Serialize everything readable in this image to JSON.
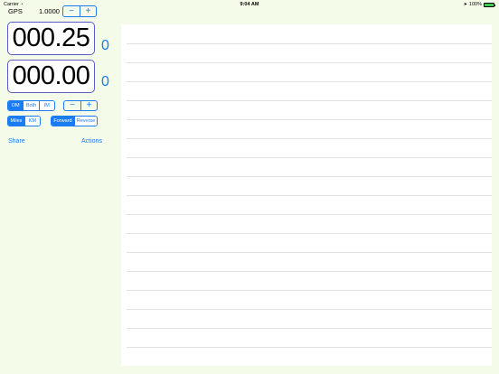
{
  "status_bar": {
    "carrier": "Carrier",
    "time": "9:04 AM",
    "battery": "100%"
  },
  "gps": {
    "label": "GPS",
    "value": "1.0000",
    "decrement": "−",
    "increment": "+"
  },
  "odometers": [
    {
      "reading": "000.25",
      "count": "0"
    },
    {
      "reading": "000.00",
      "count": "0"
    }
  ],
  "mode_selector": {
    "options": [
      "OM",
      "Both",
      "IM"
    ],
    "selected": "OM"
  },
  "mode_stepper": {
    "decrement": "−",
    "increment": "+"
  },
  "unit_selector": {
    "options": [
      "Miles",
      "KM"
    ],
    "selected": "Miles"
  },
  "direction_selector": {
    "options": [
      "Forward",
      "Reverse"
    ],
    "selected": "Forward"
  },
  "actions": {
    "share": "Share",
    "actions": "Actions"
  },
  "colors": {
    "background": "#f4fbe9",
    "accent": "#1b7cf2",
    "odometer_border": "#5a5cc8"
  }
}
